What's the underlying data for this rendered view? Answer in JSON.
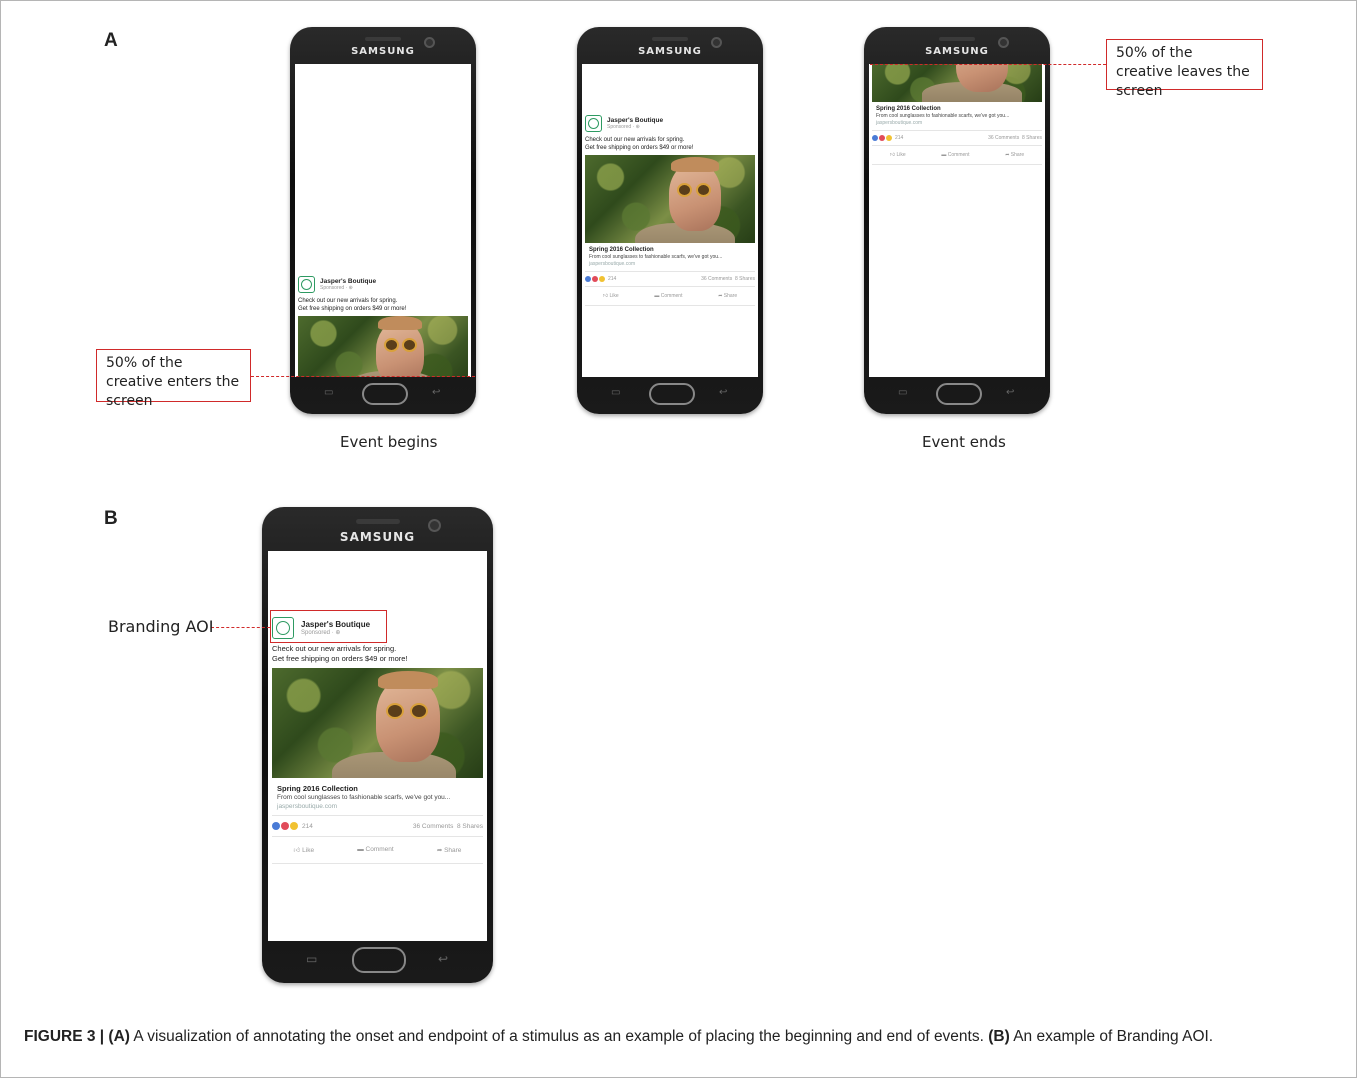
{
  "panels": {
    "a": {
      "label": "A",
      "captions": {
        "left": "Event begins",
        "right": "Event ends"
      },
      "annotations": {
        "enters": "50% of the creative enters the screen",
        "leaves": "50% of the creative leaves the screen"
      }
    },
    "b": {
      "label": "B",
      "annotation": "Branding AOI"
    }
  },
  "phone": {
    "brand": "SAMSUNG"
  },
  "ad": {
    "page_name": "Jasper's Boutique",
    "sponsored": "Sponsored · ⊕",
    "text_line1": "Check out our new arrivals for spring.",
    "text_line2": "Get free shipping on orders $49 or more!",
    "link_title": "Spring 2016 Collection",
    "link_desc": "From cool sunglasses to fashionable scarfs, we've got you...",
    "link_domain": "jaspersboutique.com",
    "reaction_count": "214",
    "comments": "36 Comments",
    "shares": "8 Shares",
    "actions": {
      "like": "Like",
      "comment": "Comment",
      "share": "Share"
    }
  },
  "figure_caption": {
    "prefix": "FIGURE 3 | (A)",
    "part_a": " A visualization of annotating the onset and endpoint of a stimulus as an example of placing the beginning and end of events. ",
    "b_label": "(B)",
    "part_b": " An example of Branding AOI."
  },
  "colors": {
    "annotation_red": "#d02a2a",
    "brand_green": "#2e9a62"
  }
}
